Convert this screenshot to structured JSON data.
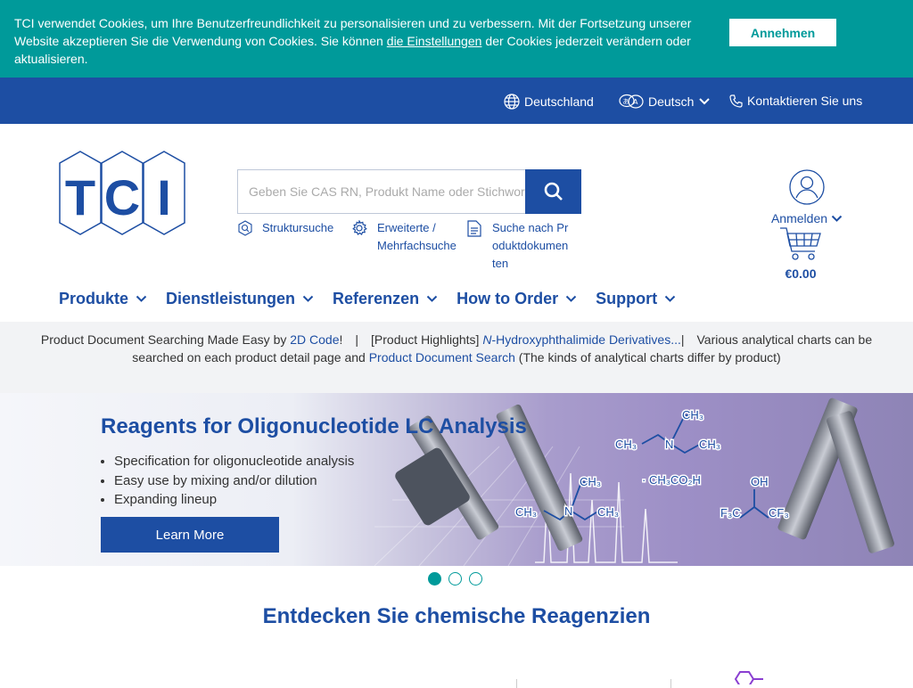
{
  "cookie": {
    "text_before": "TCI verwendet Cookies, um Ihre Benutzerfreundlichkeit zu personalisieren und zu verbessern. Mit der Fortsetzung unserer Website akzeptieren Sie die Verwendung von Cookies. Sie können",
    "link": "die Einstellungen",
    "text_after": "der Cookies jederzeit verändern oder aktualisieren.",
    "accept_label": "Annehmen"
  },
  "topbar": {
    "country": "Deutschland",
    "language": "Deutsch",
    "contact": "Kontaktieren Sie uns"
  },
  "header": {
    "logo_text": "TCI",
    "search_placeholder": "Geben Sie CAS RN, Produkt Name oder Stichwort ein",
    "tools": [
      {
        "label": "Struktursuche",
        "icon": "structure-search-icon"
      },
      {
        "label": "Erweiterte / Mehrfachsuche",
        "icon": "gear-icon"
      },
      {
        "label": "Suche nach Produktdokumenten",
        "icon": "document-icon"
      }
    ],
    "account_label": "Anmelden",
    "cart_amount": "€0.00"
  },
  "nav": [
    "Produkte",
    "Dienstleistungen",
    "Referenzen",
    "How to Order",
    "Support"
  ],
  "announcement": {
    "p1": "Product Document Searching Made Easy by ",
    "link1": "2D Code",
    "p2": "!　|　[Product Highlights] ",
    "link2_italic": "N",
    "link2": "-Hydroxyphthalimide Derivatives...",
    "p3": "|　Various analytical charts can be searched on each product detail page and ",
    "link3": "Product Document Search",
    "p4": " (The kinds of analytical charts differ by product)"
  },
  "hero": {
    "title": "Reagents for Oligonucleotide LC Analysis",
    "bullets": [
      "Specification for oligonucleotide analysis",
      "Easy use by mixing and/or dilution",
      "Expanding lineup"
    ],
    "button": "Learn More",
    "slides": 3,
    "active_slide": 1
  },
  "section_title": "Entdecken Sie chemische Reagenzien",
  "colors": {
    "brand_blue": "#1d4ea3",
    "teal": "#009a9a",
    "light_gray": "#f2f3f5"
  }
}
